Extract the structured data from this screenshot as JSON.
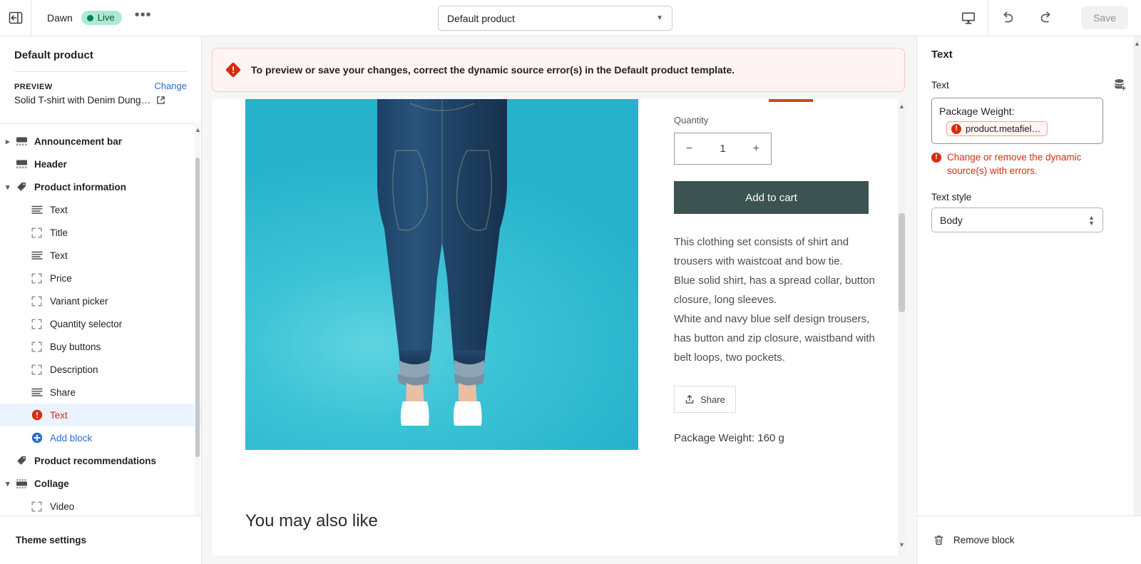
{
  "topbar": {
    "exit_icon": "exit-icon",
    "theme_name": "Dawn",
    "live_label": "Live",
    "more_label": "•••",
    "template_selected": "Default product",
    "device_icon": "desktop-icon",
    "undo_icon": "undo-icon",
    "redo_icon": "redo-icon",
    "save_label": "Save"
  },
  "sidebar": {
    "title": "Default product",
    "preview_label": "PREVIEW",
    "change_label": "Change",
    "preview_value": "Solid T-shirt with Denim Dung…",
    "external_icon": "external-link-icon",
    "items": [
      {
        "label": "Announcement bar",
        "level": "section",
        "icon": "announcement-bar-icon",
        "arrow": "right"
      },
      {
        "label": "Header",
        "level": "section",
        "icon": "header-icon",
        "arrow": "none"
      },
      {
        "label": "Product information",
        "level": "section",
        "icon": "tag-icon",
        "arrow": "down"
      },
      {
        "label": "Text",
        "level": "child",
        "icon": "text-lines-icon",
        "arrow": "none"
      },
      {
        "label": "Title",
        "level": "child",
        "icon": "placeholder-icon",
        "arrow": "none"
      },
      {
        "label": "Text",
        "level": "child",
        "icon": "text-lines-icon",
        "arrow": "none"
      },
      {
        "label": "Price",
        "level": "child",
        "icon": "placeholder-icon",
        "arrow": "none"
      },
      {
        "label": "Variant picker",
        "level": "child",
        "icon": "placeholder-icon",
        "arrow": "none"
      },
      {
        "label": "Quantity selector",
        "level": "child",
        "icon": "placeholder-icon",
        "arrow": "none"
      },
      {
        "label": "Buy buttons",
        "level": "child",
        "icon": "placeholder-icon",
        "arrow": "none"
      },
      {
        "label": "Description",
        "level": "child",
        "icon": "placeholder-icon",
        "arrow": "none"
      },
      {
        "label": "Share",
        "level": "child",
        "icon": "text-lines-icon",
        "arrow": "none"
      },
      {
        "label": "Text",
        "level": "child",
        "icon": "error-icon",
        "arrow": "none",
        "state": "selected-error"
      },
      {
        "label": "Add block",
        "level": "child",
        "icon": "plus-circle-icon",
        "arrow": "none",
        "state": "add"
      },
      {
        "label": "Product recommendations",
        "level": "section",
        "icon": "tag-icon",
        "arrow": "none"
      },
      {
        "label": "Collage",
        "level": "section",
        "icon": "collage-icon",
        "arrow": "down"
      },
      {
        "label": "Video",
        "level": "child",
        "icon": "placeholder-icon",
        "arrow": "none"
      }
    ],
    "footer_label": "Theme settings"
  },
  "banner": {
    "icon": "error-diamond-icon",
    "message": "To preview or save your changes, correct the dynamic source error(s) in the Default product template."
  },
  "preview": {
    "quantity_label": "Quantity",
    "quantity_minus": "−",
    "quantity_value": "1",
    "quantity_plus": "+",
    "add_to_cart": "Add to cart",
    "description": "This clothing set consists of shirt and trousers with waistcoat and bow tie.\nBlue solid shirt, has a spread collar, button closure, long sleeves.\nWhite and navy blue self design trousers, has button and zip closure, waistband with belt loops, two pockets.",
    "share_label": "Share",
    "share_icon": "share-upload-icon",
    "package_weight": "Package Weight: 160 g",
    "you_may_also_like": "You may also like"
  },
  "right_panel": {
    "title": "Text",
    "text_label": "Text",
    "dynamic_source_icon": "dynamic-source-add-icon",
    "text_value": "Package Weight:",
    "dynamic_chip": "product.metafiel…",
    "error_message": "Change or remove the dynamic source(s) with errors.",
    "text_style_label": "Text style",
    "text_style_value": "Body",
    "remove_block_label": "Remove block",
    "remove_icon": "trash-icon"
  },
  "colors": {
    "error_red": "#d72c0d",
    "link_blue": "#2c6ecb",
    "live_green_bg": "#aee9d1",
    "live_green_text": "#0c5132",
    "selected_bg": "#eaf4fe",
    "add_to_cart_bg": "#3b5451",
    "banner_bg": "#fff4f4",
    "banner_border": "#fcc8c3"
  }
}
